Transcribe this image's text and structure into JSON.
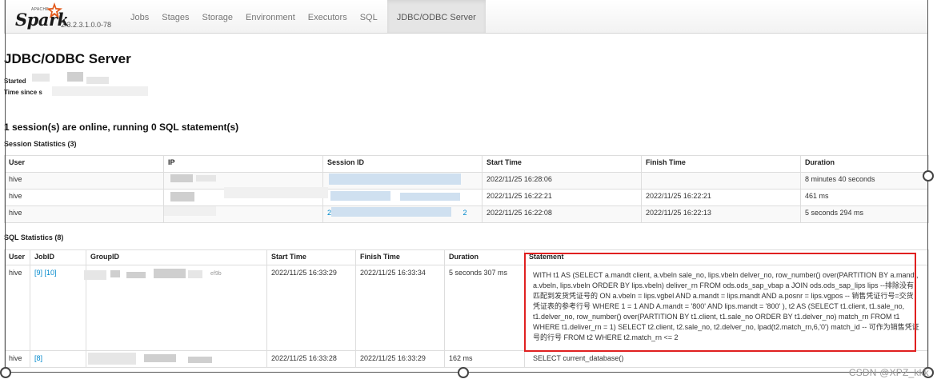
{
  "navbar": {
    "logo_text": "Spark",
    "logo_apache": "APACHE",
    "version": "2.3.2.3.1.0.0-78",
    "tabs": [
      "Jobs",
      "Stages",
      "Storage",
      "Environment",
      "Executors",
      "SQL"
    ],
    "active_tab": "JDBC/ODBC Server"
  },
  "page": {
    "title": "JDBC/ODBC Server",
    "started_label": "Started",
    "time_since_label": "Time since s",
    "online_heading": "1 session(s) are online, running 0 SQL statement(s)",
    "session_stats_label": "Session Statistics (3)",
    "sql_stats_label": "SQL Statistics (8)"
  },
  "session_table": {
    "columns": [
      "User",
      "IP",
      "Session ID",
      "Start Time",
      "Finish Time",
      "Duration"
    ],
    "rows": [
      {
        "user": "hive",
        "ip_visible": "",
        "session_visible": "",
        "start": "2022/11/25 16:28:06",
        "finish": "",
        "duration": "8 minutes 40 seconds"
      },
      {
        "user": "hive",
        "ip_visible": "",
        "session_visible": "",
        "start": "2022/11/25 16:22:21",
        "finish": "2022/11/25 16:22:21",
        "duration": "461 ms"
      },
      {
        "user": "hive",
        "ip_visible": "",
        "session_prefix": "2",
        "session_suffix": "2",
        "start": "2022/11/25 16:22:08",
        "finish": "2022/11/25 16:22:13",
        "duration": "5 seconds 294 ms"
      }
    ]
  },
  "sql_table": {
    "columns": [
      "User",
      "JobID",
      "GroupID",
      "Start Time",
      "Finish Time",
      "Duration",
      "Statement"
    ],
    "rows": [
      {
        "user": "hive",
        "job_ids": "[9] [10]",
        "group_tail": "ef9b",
        "start": "2022/11/25 16:33:29",
        "finish": "2022/11/25 16:33:34",
        "duration": "5 seconds 307 ms",
        "statement": "WITH t1 AS (SELECT a.mandt client, a.vbeln sale_no, lips.vbeln delver_no, row_number() over(PARTITION BY a.mandt, a.vbeln, lips.vbeln ORDER BY lips.vbeln) deliver_rn FROM ods.ods_sap_vbap a JOIN ods.ods_sap_lips lips --排除没有匹配到发货凭证号的 ON a.vbeln = lips.vgbel AND a.mandt = lips.mandt AND a.posnr = lips.vgpos -- 销售凭证行号=交货凭证表的参考行号 WHERE 1 = 1 AND A.mandt = '800' AND lips.mandt = '800' ), t2 AS (SELECT t1.client, t1.sale_no, t1.delver_no, row_number() over(PARTITION BY t1.client, t1.sale_no ORDER BY t1.delver_no) match_rn FROM t1 WHERE t1.deliver_rn = 1) SELECT t2.client, t2.sale_no, t2.delver_no, lpad(t2.match_rn,6,'0') match_id -- 可作为销售凭证号的行号 FROM t2 WHERE t2.match_rn <= 2"
      },
      {
        "user": "hive",
        "job_ids": "[8]",
        "group_tail": "",
        "start": "2022/11/25 16:33:28",
        "finish": "2022/11/25 16:33:29",
        "duration": "162 ms",
        "statement": "SELECT current_database()"
      }
    ]
  },
  "watermark": "CSDN @XPZ_kkk",
  "colors": {
    "highlight": "#e02020",
    "link": "#0088cc"
  }
}
